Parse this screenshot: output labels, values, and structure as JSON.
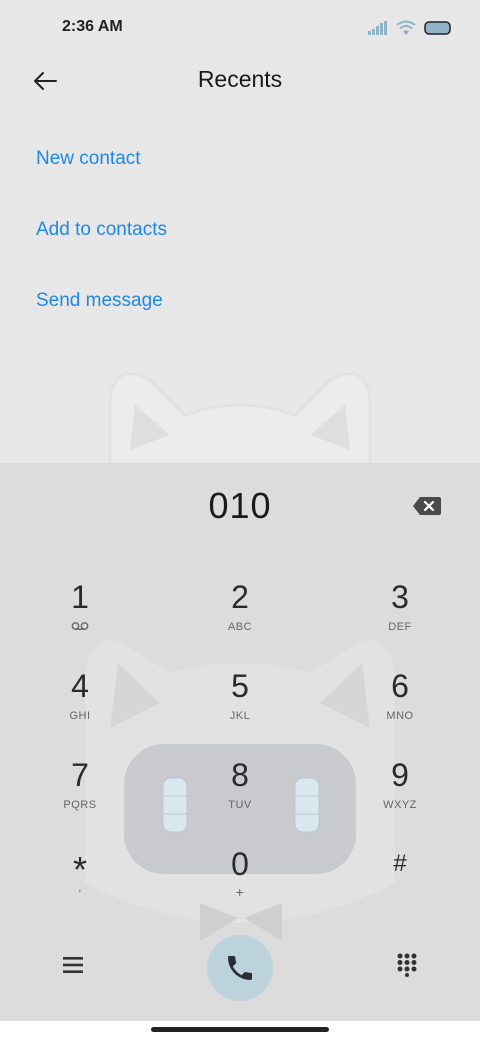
{
  "status_bar": {
    "time": "2:36 AM",
    "icons": [
      "signal-icon",
      "wifi-icon",
      "battery-icon"
    ]
  },
  "header": {
    "title": "Recents",
    "back_icon": "arrow-left-icon"
  },
  "actions": [
    {
      "label": "New contact"
    },
    {
      "label": "Add to contacts"
    },
    {
      "label": "Send message"
    }
  ],
  "dialer": {
    "number": "010",
    "backspace_icon": "backspace-icon",
    "keys": [
      {
        "digit": "1",
        "letters": "",
        "icon": "voicemail-icon"
      },
      {
        "digit": "2",
        "letters": "ABC"
      },
      {
        "digit": "3",
        "letters": "DEF"
      },
      {
        "digit": "4",
        "letters": "GHI"
      },
      {
        "digit": "5",
        "letters": "JKL"
      },
      {
        "digit": "6",
        "letters": "MNO"
      },
      {
        "digit": "7",
        "letters": "PQRS"
      },
      {
        "digit": "8",
        "letters": "TUV"
      },
      {
        "digit": "9",
        "letters": "WXYZ"
      },
      {
        "digit": "*",
        "letters": ","
      },
      {
        "digit": "0",
        "letters": "+"
      },
      {
        "digit": "#",
        "letters": ""
      }
    ]
  },
  "bottom_bar": {
    "menu_icon": "menu-icon",
    "call_icon": "phone-icon",
    "keypad_icon": "dialpad-icon"
  },
  "colors": {
    "accent": "#1e88e5",
    "call_button": "#bcd3dc",
    "dialer_bg": "#dcdcdc",
    "page_bg": "#e7e7e7"
  }
}
